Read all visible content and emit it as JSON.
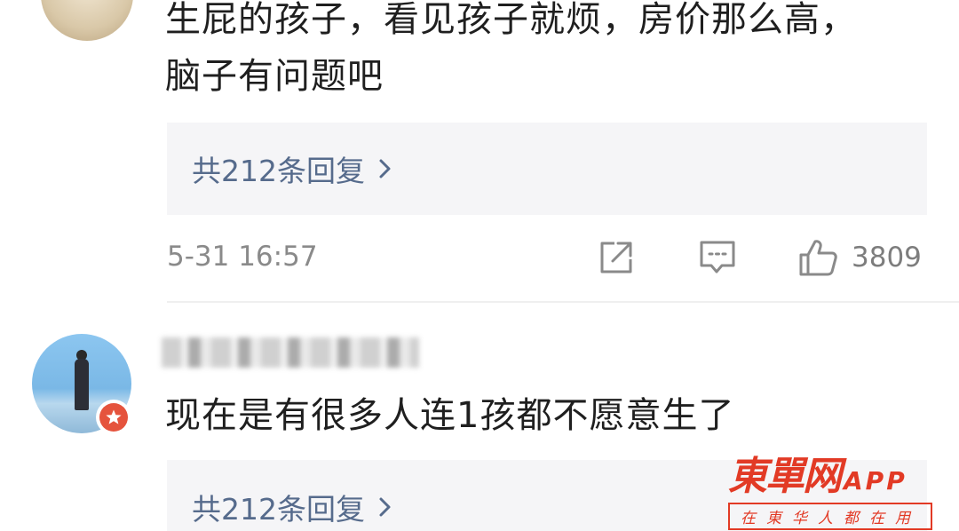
{
  "comments": [
    {
      "text_lines": [
        "生屁的孩子，看见孩子就烦，房价那么高，",
        "脑子有问题吧"
      ],
      "replies_label": "共212条回复",
      "timestamp": "5-31 16:57",
      "likes": "3809"
    },
    {
      "text": "现在是有很多人连1孩都不愿意生了",
      "replies_label": "共212条回复"
    }
  ],
  "icons": {
    "reply_chevron": "chevron-right-icon",
    "share": "share-icon",
    "comment": "comment-icon",
    "like": "thumbs-up-icon",
    "verified_badge": "star-badge-icon"
  },
  "watermark": {
    "brand": "東單网",
    "app": "APP",
    "tagline": "在東华人都在用"
  },
  "colors": {
    "link": "#566b8c",
    "reply_box_bg": "#f5f5f7",
    "muted_text": "#8a8a8a",
    "watermark_red": "#e23a25",
    "badge_red": "#e5533d"
  }
}
